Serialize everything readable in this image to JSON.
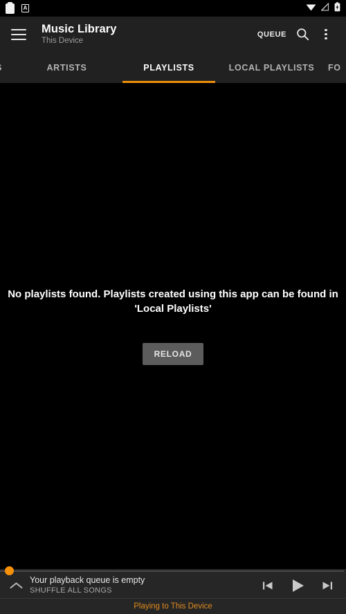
{
  "statusbar": {
    "left_icons": [
      {
        "name": "clipboard-notification-icon",
        "glyph": "clipboard"
      },
      {
        "name": "letter-a-notification-icon",
        "glyph": "A"
      }
    ],
    "right_icons": [
      {
        "name": "wifi-icon",
        "glyph": "wifi"
      },
      {
        "name": "cellular-signal-off-icon",
        "glyph": "signal-slash"
      },
      {
        "name": "battery-charging-icon",
        "glyph": "battery-bolt"
      }
    ]
  },
  "appbar": {
    "menu_icon": "hamburger-menu-icon",
    "title": "Music Library",
    "subtitle": "This Device",
    "queue_label": "QUEUE",
    "search_icon": "search-icon",
    "overflow_icon": "more-vertical-icon"
  },
  "tabs": {
    "active_index": 2,
    "accent": "#ef9009",
    "items": [
      {
        "label": "S",
        "partial": true
      },
      {
        "label": "ARTISTS",
        "partial": false
      },
      {
        "label": "PLAYLISTS",
        "partial": false
      },
      {
        "label": "LOCAL PLAYLISTS",
        "partial": false
      },
      {
        "label": "FO",
        "partial": true
      }
    ]
  },
  "content": {
    "empty_message": "No playlists found. Playlists created using this app can be found in 'Local Playlists'",
    "reload_label": "RELOAD",
    "background": "#000000"
  },
  "player": {
    "progress_percent": 0,
    "thumb_color": "#f79009",
    "expand_icon": "chevron-up-icon",
    "line1": "Your playback queue is empty",
    "line2": "SHUFFLE ALL SONGS",
    "controls": [
      {
        "name": "previous-track-button",
        "glyph": "skip-previous"
      },
      {
        "name": "play-button",
        "glyph": "play"
      },
      {
        "name": "next-track-button",
        "glyph": "skip-next"
      }
    ],
    "cast_status": "Playing to This Device",
    "cast_status_color": "#e08b1d"
  }
}
